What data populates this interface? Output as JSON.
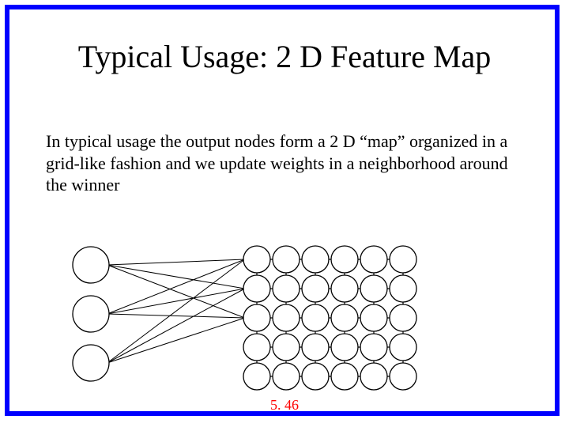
{
  "title": "Typical Usage: 2 D Feature Map",
  "body": "In typical usage the output nodes form a 2 D “map” organized in a grid-like fashion and we update weights in a neighborhood around the winner",
  "page_number": "5. 46",
  "diagram": {
    "input_nodes": 3,
    "grid_rows": 5,
    "grid_cols": 6,
    "input_circle_radius": 23,
    "grid_circle_radius": 17,
    "grid_spacing": 37
  }
}
